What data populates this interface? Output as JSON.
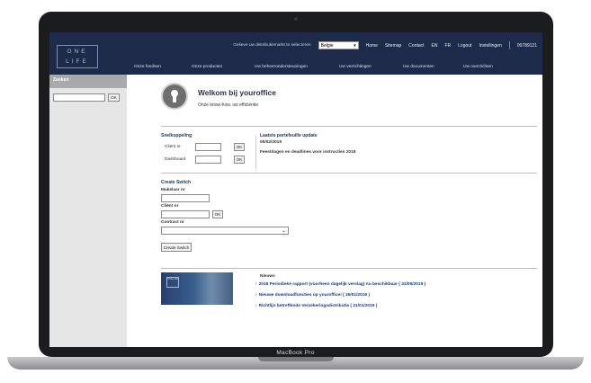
{
  "device": {
    "model_label": "MacBook Pro"
  },
  "header": {
    "logo_line1": "ONE",
    "logo_line2": "LIFE",
    "select_prompt": "Gelieve uw distributiemarkt te selecteren",
    "country_value": "Belgie",
    "links": [
      "Home",
      "Sitemap",
      "Contact",
      "EN",
      "FR",
      "Logout",
      "Instellingen"
    ],
    "user_id": "09789121"
  },
  "nav": [
    "Onze fondsen",
    "Onze producten",
    "Uw beheerondersteuningen",
    "Uw verrichtingen",
    "Uw documenten",
    "Uw overzichten"
  ],
  "sidebar": {
    "title": "Zoeken",
    "ok_label": "OK"
  },
  "welcome": {
    "title": "Welkom bij youroffice",
    "subtitle": "Onze know-how, uw efficiëntie"
  },
  "snelkoppeling": {
    "title": "Snelkoppeling",
    "client_label": "Cliënt nr",
    "dashboard_label": "Dashboard",
    "ok_label": "OK"
  },
  "portfolio": {
    "title": "Laatste portefeuille update",
    "date": "05/02/2019",
    "note": "Feestdagen en deadlines voor instructies 2018"
  },
  "create_switch": {
    "title": "Create Switch",
    "makelaar_label": "Makelaar nr",
    "client_label": "Cliënt nr",
    "contract_label": "Contract nr",
    "ok_label": "OK",
    "button_label": "Create Switch"
  },
  "news": {
    "title": "Nieuws",
    "image_logo": "ONE LIFE",
    "items": [
      "2018 Periodieke rapport (voorheen dagelijk verslag) nu beschikbaar ( 31/05/2019 )",
      "Nieuwe downloadfuncties op youroffice! ( 25/01/2019 )",
      "Richtlijn betreffende Verzekeringsdistributie ( 21/01/2019 )"
    ]
  },
  "colors": {
    "header_bg": "#1e2a4a",
    "accent": "#1e3a6e",
    "sidebar_bg": "#e6e6e6"
  }
}
